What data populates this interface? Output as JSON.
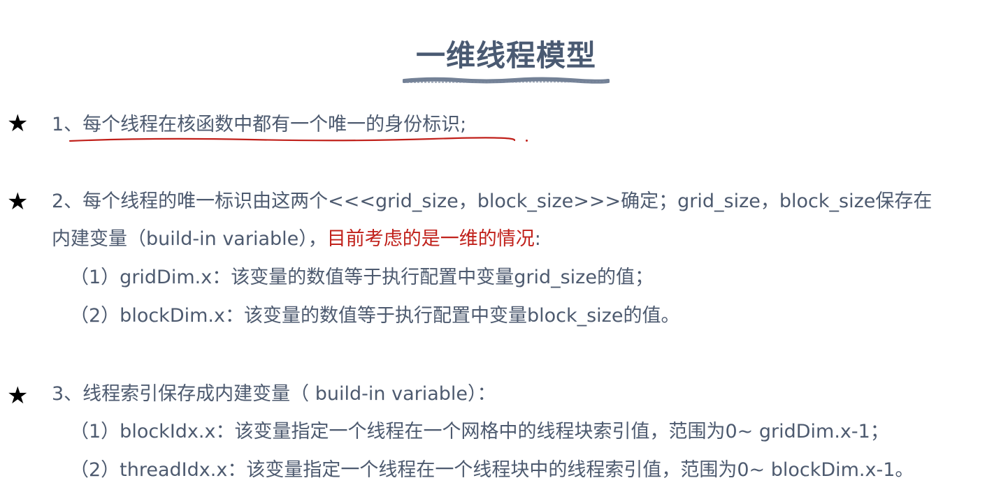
{
  "title": "一维线程模型",
  "items": [
    {
      "star": "★",
      "lines": [
        "1、每个线程在核函数中都有一个唯一的身份标识;"
      ]
    },
    {
      "star": "★",
      "line1": "2、每个线程的唯一标识由这两个<<<grid_size，block_size>>>确定；grid_size，block_size保存在",
      "line2_plain": "内建变量（build-in variable），",
      "line2_red": "目前考虑的是一维的情况",
      "line2_end": ":",
      "sub": [
        "（1）gridDim.x：该变量的数值等于执行配置中变量grid_size的值；",
        "（2）blockDim.x：该变量的数值等于执行配置中变量block_size的值。"
      ]
    },
    {
      "star": "★",
      "line1": "3、线程索引保存成内建变量（ build-in variable）：",
      "sub": [
        "（1）blockIdx.x：该变量指定一个线程在一个网格中的线程块索引值，范围为0~ gridDim.x-1；",
        "（2）threadIdx.x：该变量指定一个线程在一个线程块中的线程索引值，范围为0~  blockDim.x-1。"
      ]
    }
  ],
  "colors": {
    "text": "#4d5a6f",
    "title": "#4a5a72",
    "highlight": "#c0201a",
    "star": "#000000"
  }
}
